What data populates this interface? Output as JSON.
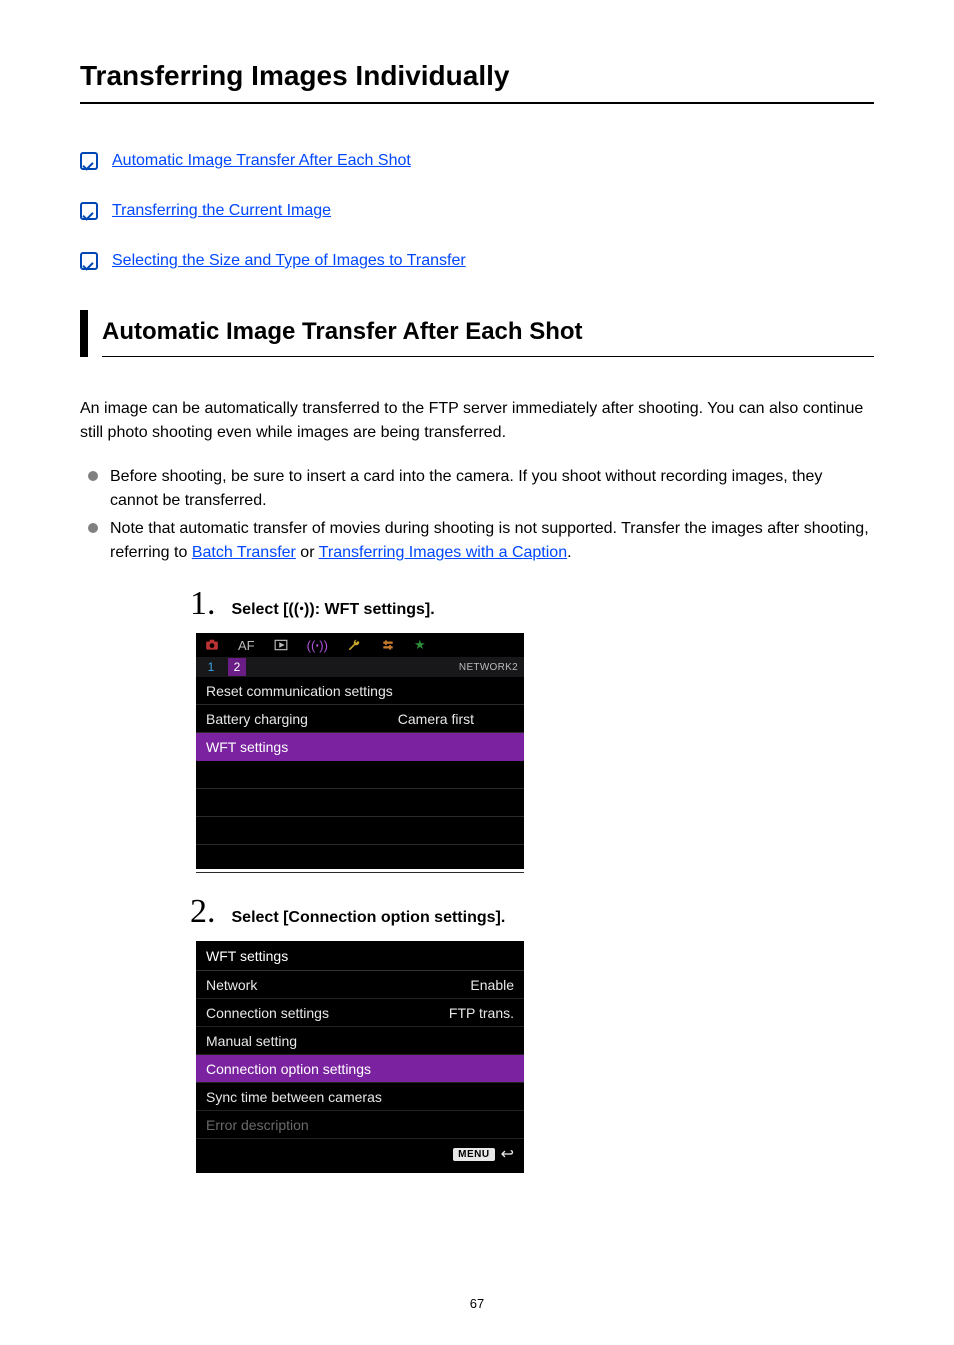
{
  "title": "Transferring Images Individually",
  "toc": {
    "item1": "Automatic Image Transfer After Each Shot",
    "item2": "Transferring the Current Image",
    "item3": "Selecting the Size and Type of Images to Transfer"
  },
  "section_heading": "Automatic Image Transfer After Each Shot",
  "para1": "An image can be automatically transferred to the FTP server immediately after shooting. You can also continue still photo shooting even while images are being transferred.",
  "bullet1": "Before shooting, be sure to insert a card into the camera. If you shoot without recording images, they cannot be transferred.",
  "bullet2_pre": "Note that automatic transfer of movies during shooting is not supported. Transfer the images after shooting, referring to ",
  "bullet2_link1": "Batch Transfer",
  "bullet2_mid": " or ",
  "bullet2_link2": "Transferring Images with a Caption",
  "bullet2_post": ".",
  "step1": {
    "num": "1.",
    "text_pre": "Select [",
    "icon_label": "antenna-icon",
    "text_post": ": WFT settings].",
    "menu": {
      "sub_n1": "1",
      "sub_n2": "2",
      "sub_label": "NETWORK2",
      "row1": "Reset communication settings",
      "row2_label": "Battery charging",
      "row2_value": "Camera first",
      "row3": "WFT settings"
    }
  },
  "step2": {
    "num": "2.",
    "text": "Select [Connection option settings].",
    "menu": {
      "title": "WFT settings",
      "r1_label": "Network",
      "r1_value": "Enable",
      "r2_label": "Connection settings",
      "r2_value": "FTP trans.",
      "r3": "Manual setting",
      "r4": "Connection option settings",
      "r5": "Sync time between cameras",
      "r6": "Error description",
      "menu_badge": "MENU"
    }
  },
  "page_number": "67"
}
